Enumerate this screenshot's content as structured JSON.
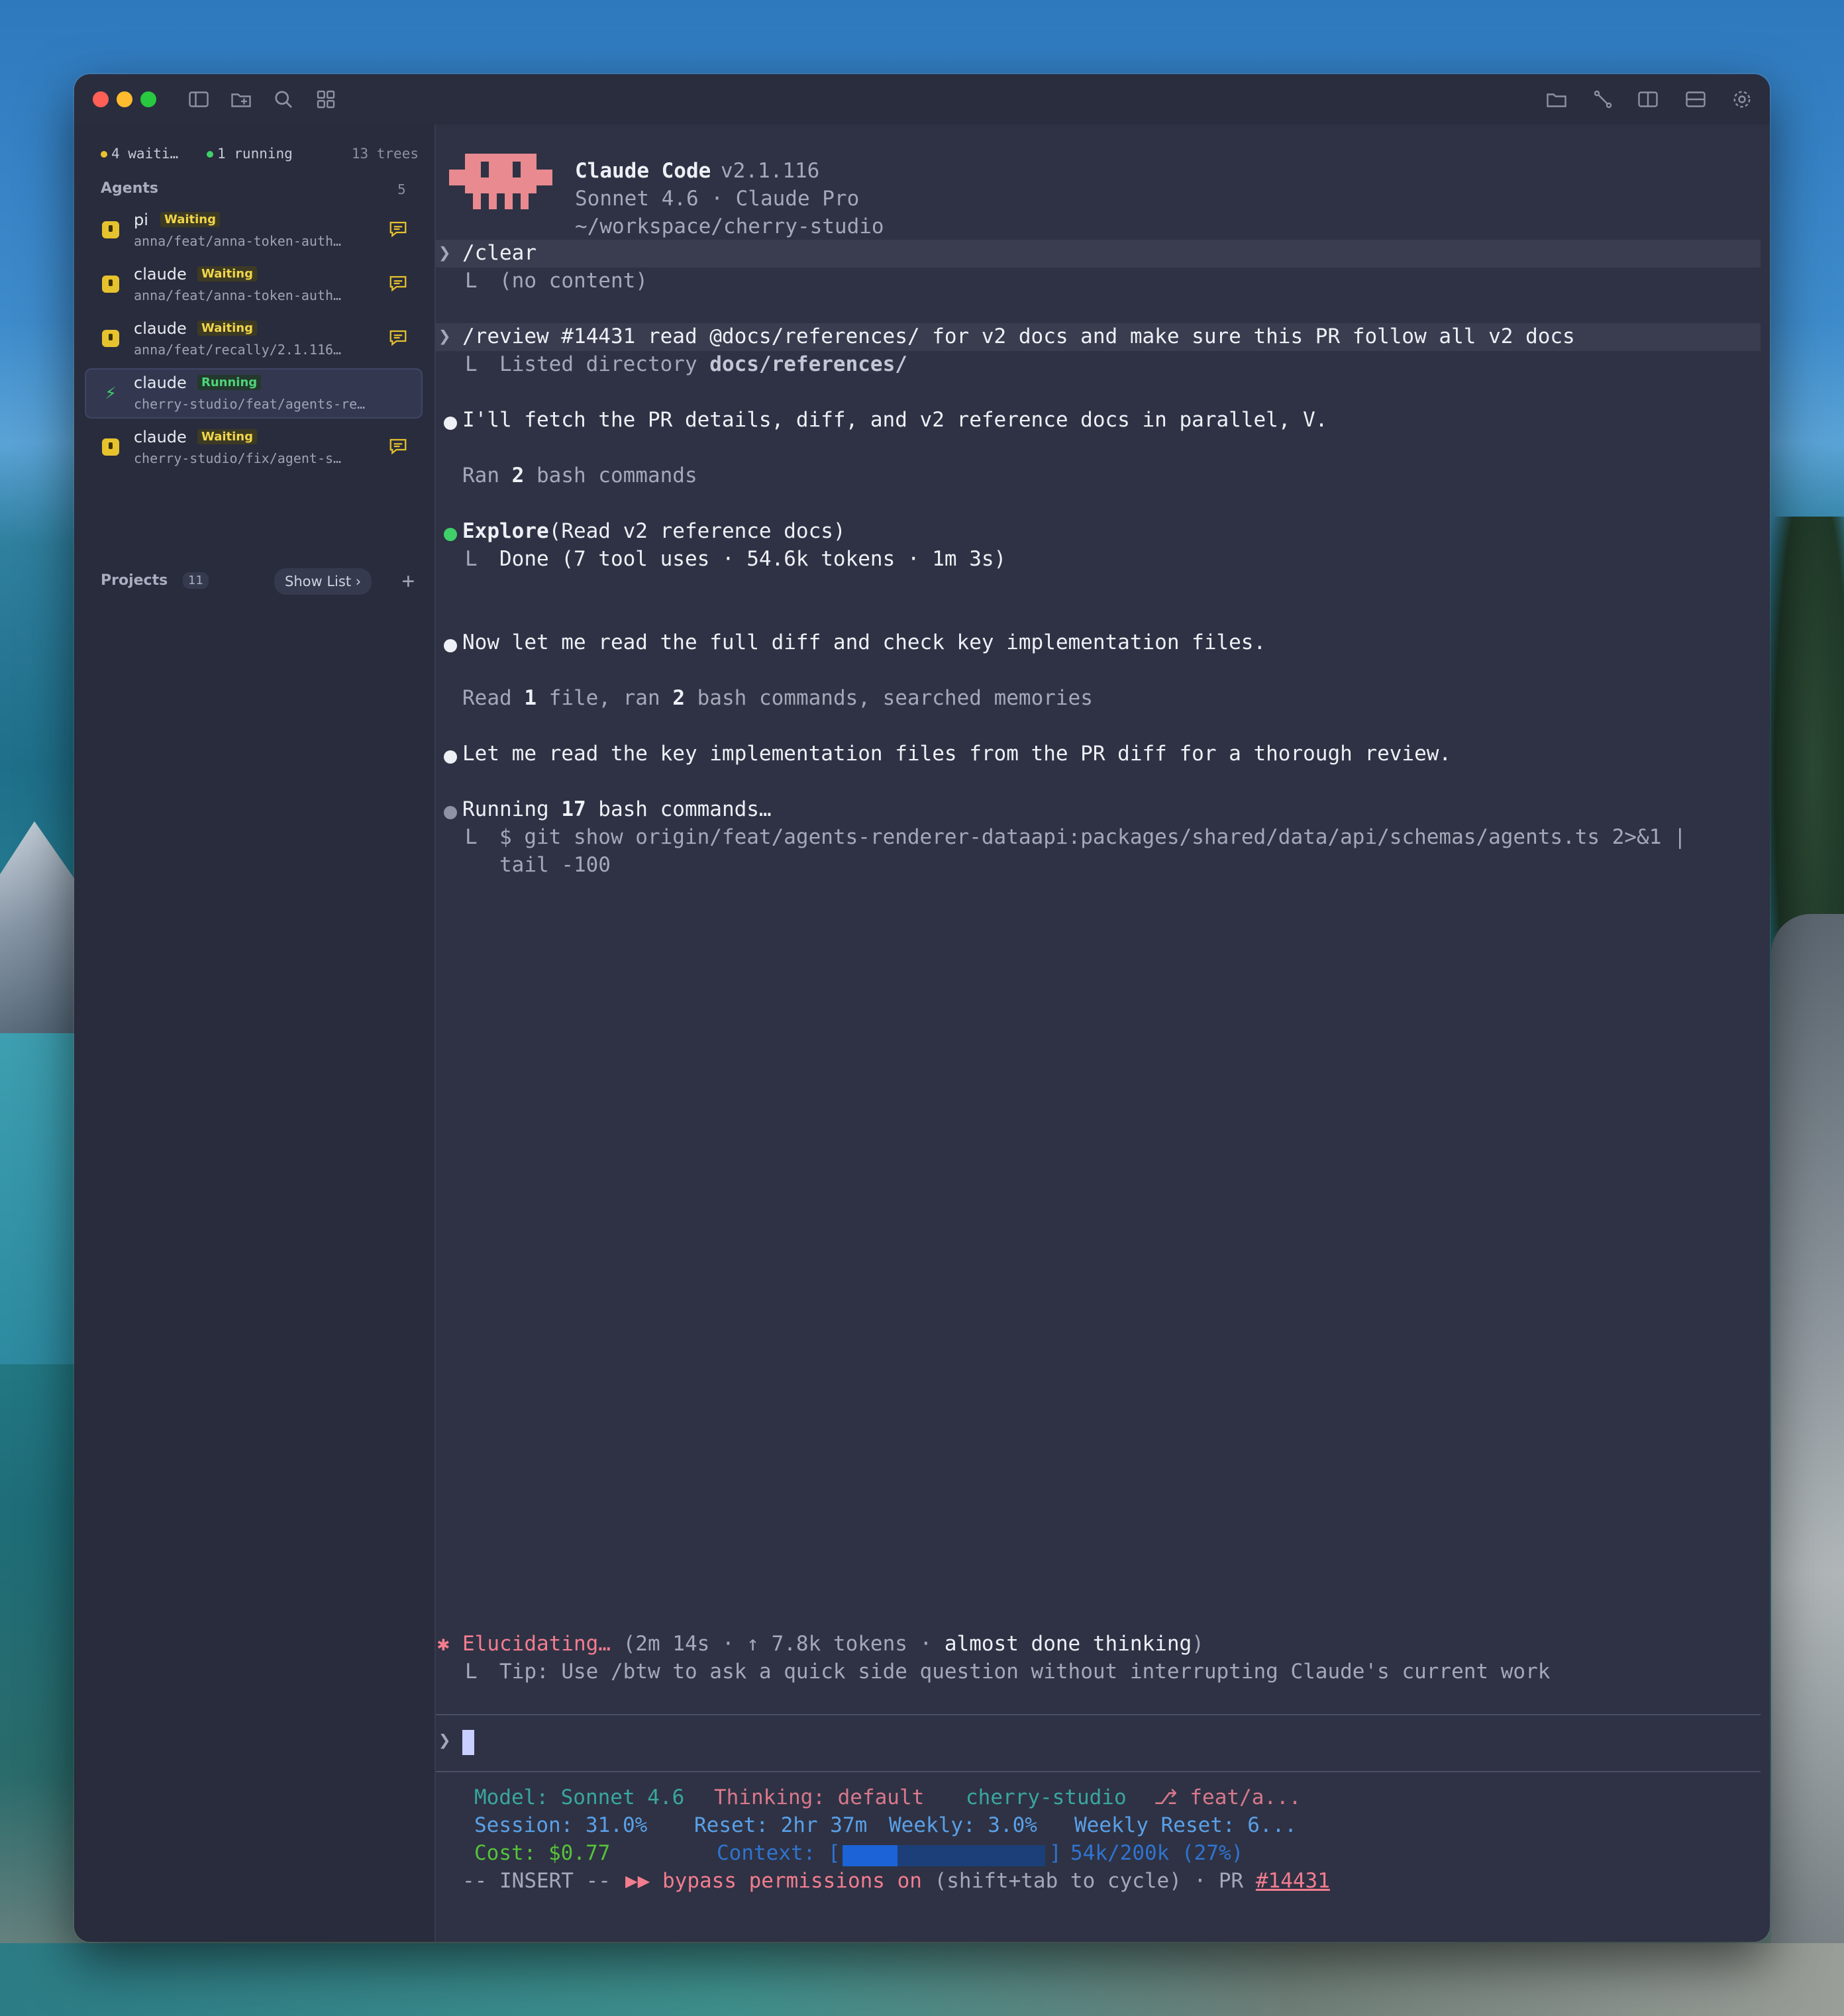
{
  "sidebar": {
    "status": {
      "waiting": "4 waiti…",
      "running": "1 running",
      "trees": "13 trees"
    },
    "agents_header": {
      "label": "Agents",
      "count": "5"
    },
    "agents": [
      {
        "name": "pi",
        "status": "Waiting",
        "path": "anna/feat/anna-token-auth…"
      },
      {
        "name": "claude",
        "status": "Waiting",
        "path": "anna/feat/anna-token-auth…"
      },
      {
        "name": "claude",
        "status": "Waiting",
        "path": "anna/feat/recally/2.1.116…"
      },
      {
        "name": "claude",
        "status": "Running",
        "path": "cherry-studio/feat/agents-re…"
      },
      {
        "name": "claude",
        "status": "Waiting",
        "path": "cherry-studio/fix/agent-s…"
      }
    ],
    "projects": {
      "label": "Projects",
      "count": "11",
      "show_list": "Show List",
      "add": "+"
    }
  },
  "terminal": {
    "header": {
      "app": "Claude Code",
      "version": "v2.1.116",
      "model_line": "Sonnet 4.6 · Claude Pro",
      "cwd": "~/workspace/cherry-studio"
    },
    "prompt_glyph": "❯",
    "branch_glyph": "L",
    "clear": {
      "cmd": "/clear",
      "result": "(no content)"
    },
    "review": {
      "cmd": "/review #14431 read @docs/references/ for v2 docs and make sure this PR follow all v2 docs",
      "result_prefix": "Listed directory ",
      "result_path": "docs/references/"
    },
    "msg1": "I'll fetch the PR details, diff, and v2 reference docs in parallel, V.",
    "ran1": {
      "a": "Ran ",
      "n": "2",
      "b": " bash commands"
    },
    "explore": {
      "name": "Explore",
      "args": "(Read v2 reference docs)",
      "result": "Done (7 tool uses · 54.6k tokens · 1m 3s)"
    },
    "msg2": "Now let me read the full diff and check key implementation files.",
    "ran2": {
      "a": "Read ",
      "n1": "1",
      "b": " file, ran ",
      "n2": "2",
      "c": " bash commands, searched memories"
    },
    "msg3": "Let me read the key implementation files from the PR diff for a thorough review.",
    "running": {
      "a": "Running ",
      "n": "17",
      "b": " bash commands…"
    },
    "git_cmd_1": "$ git show origin/feat/agents-renderer-dataapi:packages/shared/data/api/schemas/agents.ts 2>&1 |",
    "git_cmd_2": "tail -100",
    "thinking": {
      "star": "✱",
      "word": "Elucidating…",
      "stats": " (2m 14s · ↑ 7.8k tokens · ",
      "emph": "almost done thinking",
      "close": ")",
      "tip": "Tip: Use /btw to ask a quick side question without interrupting Claude's current work"
    },
    "statusline": {
      "model": "Model: Sonnet 4.6",
      "thinking": "Thinking: default",
      "project": "cherry-studio",
      "branch": "⎇ feat/a...",
      "session": "Session: 31.0%",
      "reset": "Reset: 2hr 37m",
      "weekly": "Weekly: 3.0%",
      "weekly_reset": "Weekly Reset: 6...",
      "cost": "Cost: $0.77",
      "context_label": "Context: [",
      "context_close": "]",
      "context_value": "54k/200k (27%)",
      "context_fraction": 0.27,
      "mode": "-- INSERT --",
      "bypass_arrows": "▶▶",
      "bypass": "bypass permissions on",
      "cycle": "(shift+tab to cycle) · PR ",
      "pr": "#14431"
    }
  },
  "colors": {
    "accent_pink": "#f27d8f",
    "mascot": "#e88a8f",
    "waiting": "#e6c22e",
    "running": "#3fd06a",
    "teal": "#3aa6a0",
    "blue": "#5aa0e8",
    "green": "#56c23a"
  }
}
